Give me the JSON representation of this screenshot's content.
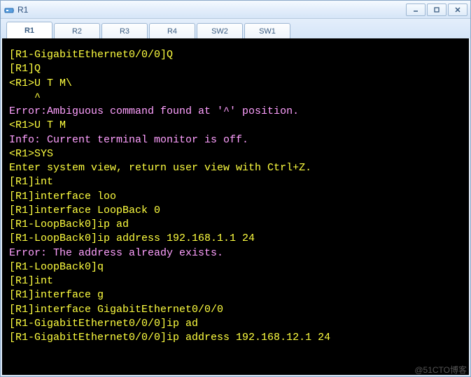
{
  "window": {
    "title": "R1"
  },
  "tabs": [
    {
      "label": "R1",
      "active": true
    },
    {
      "label": "R2",
      "active": false
    },
    {
      "label": "R3",
      "active": false
    },
    {
      "label": "R4",
      "active": false
    },
    {
      "label": "SW2",
      "active": false
    },
    {
      "label": "SW1",
      "active": false
    }
  ],
  "terminal": {
    "lines": [
      {
        "text": "",
        "cls": "yellow"
      },
      {
        "text": "[R1-GigabitEthernet0/0/0]Q",
        "cls": "yellow"
      },
      {
        "text": "[R1]Q",
        "cls": "yellow"
      },
      {
        "text": "<R1>U T M\\",
        "cls": "yellow"
      },
      {
        "text": "    ^",
        "cls": "yellow"
      },
      {
        "text": "Error:Ambiguous command found at '^' position.",
        "cls": "error"
      },
      {
        "text": "<R1>U T M",
        "cls": "yellow"
      },
      {
        "text": "Info: Current terminal monitor is off.",
        "cls": "info"
      },
      {
        "text": "<R1>SYS",
        "cls": "yellow"
      },
      {
        "text": "Enter system view, return user view with Ctrl+Z.",
        "cls": "yellow"
      },
      {
        "text": "[R1]int",
        "cls": "yellow"
      },
      {
        "text": "[R1]interface loo",
        "cls": "yellow"
      },
      {
        "text": "[R1]interface LoopBack 0",
        "cls": "yellow"
      },
      {
        "text": "[R1-LoopBack0]ip ad",
        "cls": "yellow"
      },
      {
        "text": "[R1-LoopBack0]ip address 192.168.1.1 24",
        "cls": "yellow"
      },
      {
        "text": "Error: The address already exists.",
        "cls": "error"
      },
      {
        "text": "[R1-LoopBack0]q",
        "cls": "yellow"
      },
      {
        "text": "[R1]int",
        "cls": "yellow"
      },
      {
        "text": "[R1]interface g",
        "cls": "yellow"
      },
      {
        "text": "[R1]interface GigabitEthernet0/0/0",
        "cls": "yellow"
      },
      {
        "text": "[R1-GigabitEthernet0/0/0]ip ad",
        "cls": "yellow"
      },
      {
        "text": "[R1-GigabitEthernet0/0/0]ip address 192.168.12.1 24",
        "cls": "yellow"
      }
    ]
  },
  "watermark": "@51CTO博客"
}
